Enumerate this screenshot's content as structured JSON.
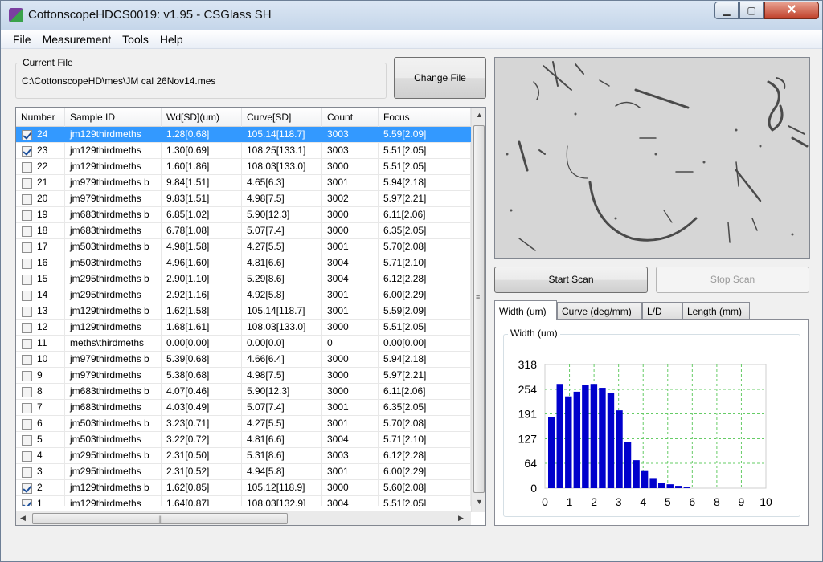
{
  "window": {
    "title": "CottonscopeHDCS0019: v1.95 - CSGlass SH",
    "min": "▁",
    "max": "▢",
    "close": "✕"
  },
  "menu": [
    "File",
    "Measurement",
    "Tools",
    "Help"
  ],
  "current_file": {
    "label": "Current File",
    "path": "C:\\CottonscopeHD\\mes\\JM cal 26Nov14.mes",
    "button": "Change File"
  },
  "table": {
    "columns": [
      "Number",
      "Sample ID",
      "Wd[SD](um)",
      "Curve[SD]",
      "Count",
      "Focus"
    ],
    "rows": [
      {
        "checked": true,
        "selected": true,
        "number": "24",
        "sample": "jm129thirdmeths",
        "wd": "1.28[0.68]",
        "curve": "105.14[118.7]",
        "count": "3003",
        "focus": "5.59[2.09]"
      },
      {
        "checked": true,
        "number": "23",
        "sample": "jm129thirdmeths",
        "wd": "1.30[0.69]",
        "curve": "108.25[133.1]",
        "count": "3003",
        "focus": "5.51[2.05]"
      },
      {
        "checked": false,
        "number": "22",
        "sample": "jm129thirdmeths",
        "wd": "1.60[1.86]",
        "curve": "108.03[133.0]",
        "count": "3000",
        "focus": "5.51[2.05]"
      },
      {
        "checked": false,
        "number": "21",
        "sample": "jm979thirdmeths b",
        "wd": "9.84[1.51]",
        "curve": "4.65[6.3]",
        "count": "3001",
        "focus": "5.94[2.18]"
      },
      {
        "checked": false,
        "number": "20",
        "sample": "jm979thirdmeths",
        "wd": "9.83[1.51]",
        "curve": "4.98[7.5]",
        "count": "3002",
        "focus": "5.97[2.21]"
      },
      {
        "checked": false,
        "number": "19",
        "sample": "jm683thirdmeths b",
        "wd": "6.85[1.02]",
        "curve": "5.90[12.3]",
        "count": "3000",
        "focus": "6.11[2.06]"
      },
      {
        "checked": false,
        "number": "18",
        "sample": "jm683thirdmeths",
        "wd": "6.78[1.08]",
        "curve": "5.07[7.4]",
        "count": "3000",
        "focus": "6.35[2.05]"
      },
      {
        "checked": false,
        "number": "17",
        "sample": "jm503thirdmeths b",
        "wd": "4.98[1.58]",
        "curve": "4.27[5.5]",
        "count": "3001",
        "focus": "5.70[2.08]"
      },
      {
        "checked": false,
        "number": "16",
        "sample": "jm503thirdmeths",
        "wd": "4.96[1.60]",
        "curve": "4.81[6.6]",
        "count": "3004",
        "focus": "5.71[2.10]"
      },
      {
        "checked": false,
        "number": "15",
        "sample": "jm295thirdmeths b",
        "wd": "2.90[1.10]",
        "curve": "5.29[8.6]",
        "count": "3004",
        "focus": "6.12[2.28]"
      },
      {
        "checked": false,
        "number": "14",
        "sample": "jm295thirdmeths",
        "wd": "2.92[1.16]",
        "curve": "4.92[5.8]",
        "count": "3001",
        "focus": "6.00[2.29]"
      },
      {
        "checked": false,
        "number": "13",
        "sample": "jm129thirdmeths b",
        "wd": "1.62[1.58]",
        "curve": "105.14[118.7]",
        "count": "3001",
        "focus": "5.59[2.09]"
      },
      {
        "checked": false,
        "number": "12",
        "sample": "jm129thirdmeths",
        "wd": "1.68[1.61]",
        "curve": "108.03[133.0]",
        "count": "3000",
        "focus": "5.51[2.05]"
      },
      {
        "checked": false,
        "number": "11",
        "sample": "meths\\thirdmeths",
        "wd": "0.00[0.00]",
        "curve": "0.00[0.0]",
        "count": "0",
        "focus": "0.00[0.00]"
      },
      {
        "checked": false,
        "number": "10",
        "sample": "jm979thirdmeths b",
        "wd": "5.39[0.68]",
        "curve": "4.66[6.4]",
        "count": "3000",
        "focus": "5.94[2.18]"
      },
      {
        "checked": false,
        "number": "9",
        "sample": "jm979thirdmeths",
        "wd": "5.38[0.68]",
        "curve": "4.98[7.5]",
        "count": "3000",
        "focus": "5.97[2.21]"
      },
      {
        "checked": false,
        "number": "8",
        "sample": "jm683thirdmeths b",
        "wd": "4.07[0.46]",
        "curve": "5.90[12.3]",
        "count": "3000",
        "focus": "6.11[2.06]"
      },
      {
        "checked": false,
        "number": "7",
        "sample": "jm683thirdmeths",
        "wd": "4.03[0.49]",
        "curve": "5.07[7.4]",
        "count": "3001",
        "focus": "6.35[2.05]"
      },
      {
        "checked": false,
        "number": "6",
        "sample": "jm503thirdmeths b",
        "wd": "3.23[0.71]",
        "curve": "4.27[5.5]",
        "count": "3001",
        "focus": "5.70[2.08]"
      },
      {
        "checked": false,
        "number": "5",
        "sample": "jm503thirdmeths",
        "wd": "3.22[0.72]",
        "curve": "4.81[6.6]",
        "count": "3004",
        "focus": "5.71[2.10]"
      },
      {
        "checked": false,
        "number": "4",
        "sample": "jm295thirdmeths b",
        "wd": "2.31[0.50]",
        "curve": "5.31[8.6]",
        "count": "3003",
        "focus": "6.12[2.28]"
      },
      {
        "checked": false,
        "number": "3",
        "sample": "jm295thirdmeths",
        "wd": "2.31[0.52]",
        "curve": "4.94[5.8]",
        "count": "3001",
        "focus": "6.00[2.29]"
      },
      {
        "checked": true,
        "number": "2",
        "sample": "jm129thirdmeths b",
        "wd": "1.62[0.85]",
        "curve": "105.12[118.9]",
        "count": "3000",
        "focus": "5.60[2.08]"
      },
      {
        "checked": true,
        "number": "1",
        "sample": "jm129thirdmeths",
        "wd": "1.64[0.87]",
        "curve": "108.03[132.9]",
        "count": "3004",
        "focus": "5.51[2.05]"
      }
    ]
  },
  "scan": {
    "start": "Start Scan",
    "stop": "Stop Scan"
  },
  "tabs": [
    "Width (um)",
    "Curve (deg/mm)",
    "L/D",
    "Length (mm)"
  ],
  "chart_data": {
    "type": "bar",
    "title": "Width (um)",
    "x_ticks": [
      "0",
      "1",
      "2",
      "3",
      "4",
      "5",
      "6",
      "8",
      "9",
      "10"
    ],
    "y_ticks": [
      "0",
      "64",
      "127",
      "191",
      "254",
      "318"
    ],
    "ylim": [
      0,
      318
    ],
    "grid": true,
    "bar_color": "#0000cc",
    "values": [
      182,
      268,
      236,
      248,
      266,
      268,
      258,
      244,
      200,
      118,
      72,
      44,
      26,
      14,
      10,
      6,
      2
    ]
  },
  "colors": {
    "selection": "#3399ff",
    "grid": "#66cc66"
  }
}
